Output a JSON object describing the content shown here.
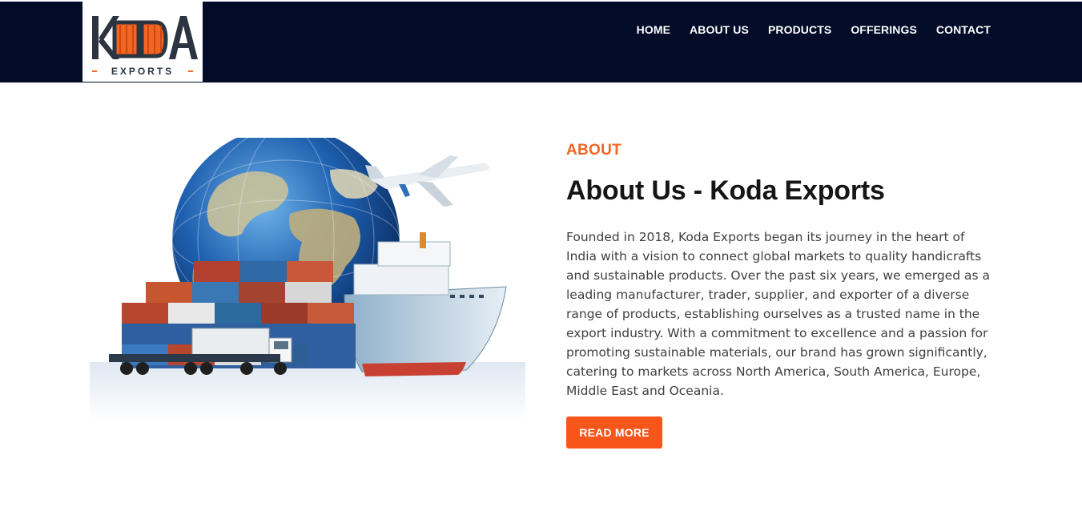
{
  "header": {
    "logo": {
      "wordmark": "KODA",
      "subtitle": "EXPORTS",
      "colors": {
        "dark": "#2b3440",
        "orange": "#f26522"
      }
    },
    "nav": [
      {
        "label": "HOME"
      },
      {
        "label": "ABOUT US"
      },
      {
        "label": "PRODUCTS"
      },
      {
        "label": "OFFERINGS"
      },
      {
        "label": "CONTACT"
      }
    ],
    "background": "#020b27"
  },
  "about": {
    "eyebrow": "ABOUT",
    "title": "About Us - Koda Exports",
    "paragraph": "Founded in 2018, Koda Exports began its journey in the heart of India with a vision to connect global markets to quality handicrafts and sustainable products. Over the past six years, we emerged as a leading manufacturer, trader, supplier, and exporter of a diverse range of products, establishing ourselves as a trusted name in the export industry. With a commitment to excellence and a passion for promoting sustainable materials, our brand has grown significantly, catering to markets across North America, South America, Europe, Middle East and Oceania.",
    "button_label": "READ MORE",
    "accent": "#f26522"
  },
  "hero_image": {
    "subject": "globe-ship-plane-truck-containers"
  }
}
